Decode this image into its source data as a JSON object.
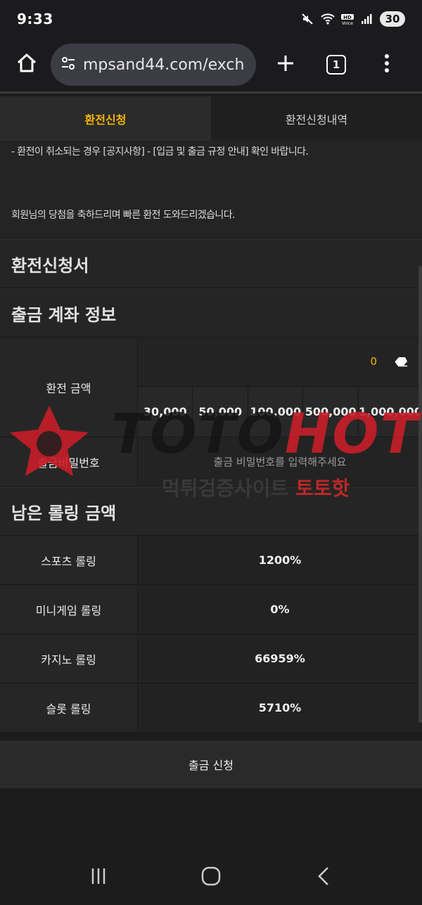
{
  "status_bar": {
    "time": "9:33",
    "battery": "30",
    "icons": [
      "mute-icon",
      "wifi-icon",
      "hd-voice-icon",
      "signal-icon"
    ]
  },
  "browser": {
    "url": "mpsand44.com/exch",
    "tab_count": "1",
    "icons": [
      "home-icon",
      "site-settings-icon",
      "plus-icon",
      "tabs-icon",
      "more-icon"
    ]
  },
  "tabs": [
    {
      "label": "환전신청",
      "active": true
    },
    {
      "label": "환전신청내역",
      "active": false
    }
  ],
  "notice": {
    "line1": "- 환전이 취소되는 경우 [공지사항] - [입금 및 출금 규정 안내] 확인 바랍니다.",
    "line2": "회원님의 당첨을 축하드리며 빠른 환전 도와드리겠습니다."
  },
  "form": {
    "title": "환전신청서",
    "account_title": "출금 계좌 정보",
    "amount_label": "환전 금액",
    "amount_value": "0",
    "quick_amounts": [
      "30,000",
      "50,000",
      "100,000",
      "500,000",
      "1,000,000"
    ],
    "password_label": "출금비밀번호",
    "password_placeholder": "출금 비밀번호를 입력해주세요"
  },
  "rolling": {
    "title": "남은 롤링 금액",
    "rows": [
      {
        "label": "스포츠 롤링",
        "value": "1200%"
      },
      {
        "label": "미니게임 롤링",
        "value": "0%"
      },
      {
        "label": "카지노 롤링",
        "value": "66959%"
      },
      {
        "label": "슬롯 롤링",
        "value": "5710%"
      }
    ]
  },
  "submit_label": "출금 신청",
  "watermark": {
    "text_a": "TOTO",
    "text_b": "HOT",
    "sub_a": "먹튀검증사이트 ",
    "sub_b": "토토핫"
  },
  "colors": {
    "accent": "#f4b400",
    "background": "#1c1c1c",
    "watermark_red": "#c81e28"
  }
}
